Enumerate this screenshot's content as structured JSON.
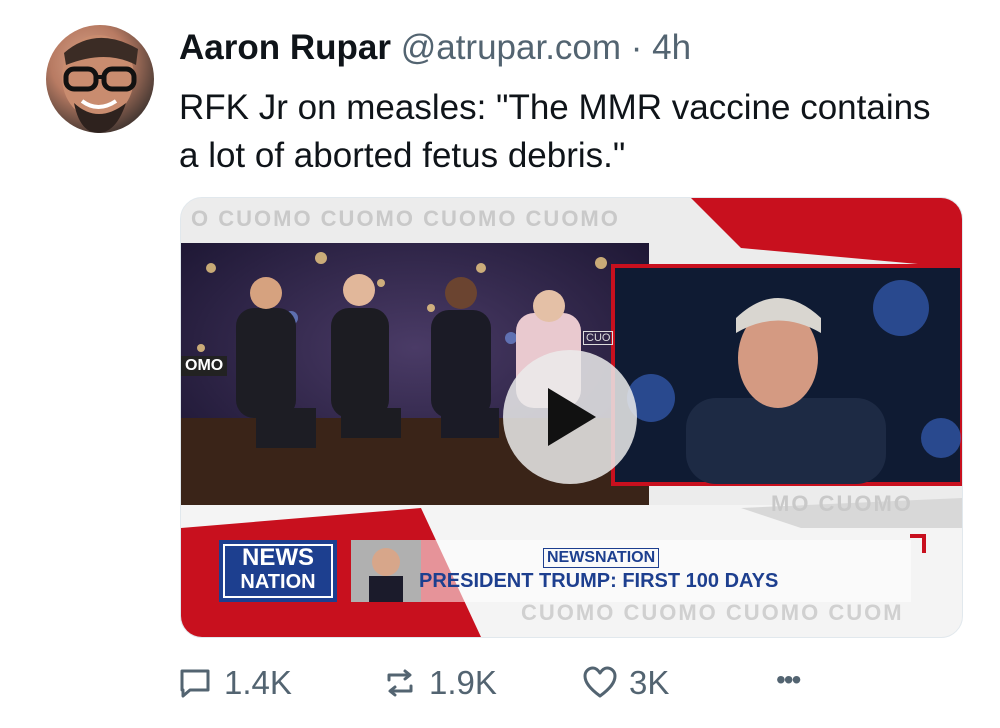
{
  "post": {
    "author_name": "Aaron Rupar",
    "handle": "@atrupar.com",
    "separator": "·",
    "time": "4h",
    "text": "RFK Jr on measles: \"The MMR vaccine contains a lot of aborted fetus debris.\""
  },
  "media": {
    "watermark_top": "O CUOMO CUOMO CUOMO CUOMO",
    "watermark_right": "MO CUOMO",
    "watermark_bottom": "CUOMO CUOMO CUOMO CUOM",
    "studio_tag_left": "OMO",
    "studio_tag_small": "CUO",
    "network_logo_line1": "NEWS",
    "network_logo_line2": "NATION",
    "lower_third_network": "NEWSNATION",
    "lower_third_headline": "PRESIDENT TRUMP: FIRST 100 DAYS"
  },
  "actions": {
    "reply_count": "1.4K",
    "repost_count": "1.9K",
    "like_count": "3K",
    "more_label": "•••"
  },
  "colors": {
    "newsnation_blue": "#1d3f8f",
    "banner_red": "#c8101e",
    "text_primary": "#0f1419",
    "text_secondary": "#536471"
  }
}
